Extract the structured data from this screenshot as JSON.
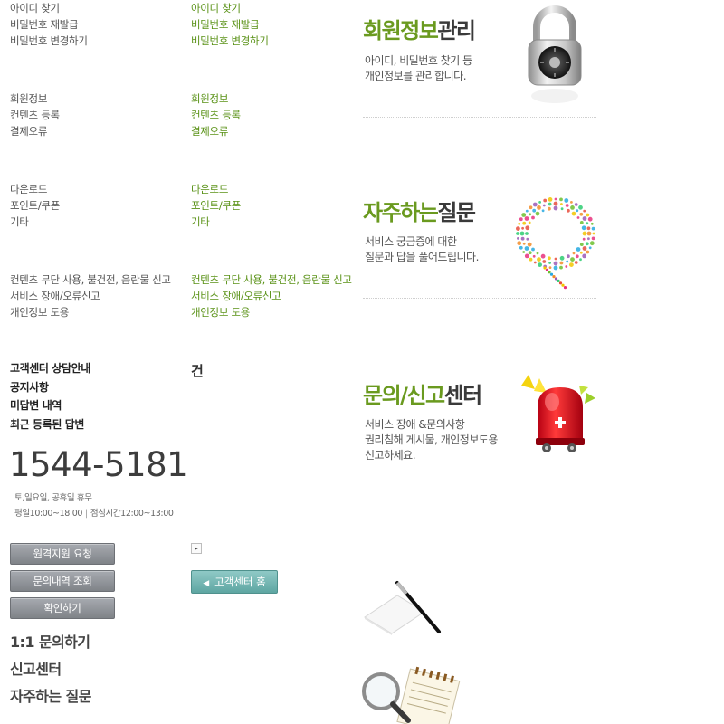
{
  "menus": {
    "account": [
      "아이디 찾기",
      "비밀번호 재발급",
      "비밀번호 변경하기"
    ],
    "member": [
      "회원정보",
      "컨텐츠 등록",
      "결제오류"
    ],
    "download": [
      "다운로드",
      "포인트/쿠폰",
      "기타"
    ],
    "report": [
      "컨텐츠  무단 사용, 불건전, 음란물 신고",
      "서비스 장애/오류신고",
      "개인정보 도용"
    ]
  },
  "cs": {
    "links": [
      "고객센터 상담안내",
      "공지사항",
      "미답변 내역",
      "최근 등록된 답변"
    ],
    "count_unit": "건",
    "phone": "1544-5181",
    "hours_line1": "토,일요일, 공휴일 휴무",
    "hours_line2a": "평일10:00~18:00",
    "hours_sep": "|",
    "hours_line2b": "점심시간12:00~13:00"
  },
  "buttons": {
    "remote": "원격지원 요청",
    "inquiry_history": "문의내역 조회",
    "confirm": "확인하기",
    "home": "고객센터 홈",
    "home_arrow": "◀",
    "mini_arrow": "▸"
  },
  "big_links": [
    "1:1 문의하기",
    "신고센터",
    "자주하는 질문"
  ],
  "sections": {
    "member": {
      "title_green": "회원정보",
      "title_dark": "관리",
      "desc_line1": "아이디, 비밀번호 찾기 등",
      "desc_line2": "개인정보를 관리합니다."
    },
    "faq": {
      "title_green": "자주하는",
      "title_dark": "질문",
      "desc_line1": "서비스 궁금증에 대한",
      "desc_line2": "질문과 답을 풀어드립니다."
    },
    "report": {
      "title_green": "문의/신고",
      "title_dark": "센터",
      "desc_line1": "서비스 장애 &문의사항",
      "desc_line2": "권리침해 게시물, 개인정보도용",
      "desc_line3": "신고하세요."
    }
  },
  "icons": {
    "member": "padlock-icon",
    "faq": "speech-bubble-icon",
    "report": "siren-icon",
    "pen": "pen-paper-icon",
    "search": "magnifier-notepad-icon"
  },
  "colors": {
    "green": "#5a9217",
    "title_green": "#6a9a1f",
    "gray_button": "#8c9095",
    "teal_button": "#6aaeaa"
  }
}
